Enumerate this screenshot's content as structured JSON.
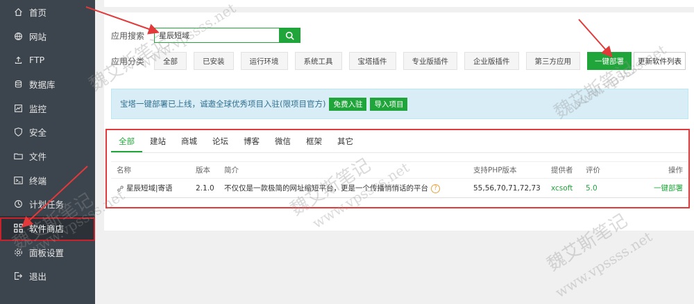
{
  "sidebar": {
    "items": [
      {
        "label": "首页",
        "icon": "home-icon"
      },
      {
        "label": "网站",
        "icon": "globe-icon"
      },
      {
        "label": "FTP",
        "icon": "upload-icon"
      },
      {
        "label": "数据库",
        "icon": "database-icon"
      },
      {
        "label": "监控",
        "icon": "monitor-icon"
      },
      {
        "label": "安全",
        "icon": "shield-icon"
      },
      {
        "label": "文件",
        "icon": "folder-icon"
      },
      {
        "label": "终端",
        "icon": "terminal-icon"
      },
      {
        "label": "计划任务",
        "icon": "clock-icon"
      },
      {
        "label": "软件商店",
        "icon": "grid-icon"
      },
      {
        "label": "面板设置",
        "icon": "gear-icon"
      },
      {
        "label": "退出",
        "icon": "logout-icon"
      }
    ],
    "active_index": 9
  },
  "search": {
    "label": "应用搜索",
    "value": "星辰短域"
  },
  "categories": {
    "label": "应用分类",
    "items": [
      "全部",
      "已安装",
      "运行环境",
      "系统工具",
      "宝塔插件",
      "专业版插件",
      "企业版插件",
      "第三方应用"
    ],
    "deploy_label": "一键部署",
    "update_label": "更新软件列表"
  },
  "banner": {
    "text": "宝塔一键部署已上线，诚邀全球优秀项目入驻(限项目官方)",
    "btn_join": "免费入驻",
    "btn_import": "导入项目"
  },
  "tabs": {
    "items": [
      "全部",
      "建站",
      "商城",
      "论坛",
      "博客",
      "微信",
      "框架",
      "其它"
    ],
    "active_index": 0
  },
  "table": {
    "headers": {
      "name": "名称",
      "version": "版本",
      "desc": "简介",
      "php": "支持PHP版本",
      "provider": "提供者",
      "rating": "评价",
      "op": "操作"
    },
    "rows": [
      {
        "name": "星辰短域|寄语",
        "version": "2.1.0",
        "desc": "不仅仅是一款极简的网址缩短平台，更是一个传播悄悄话的平台",
        "php": "55,56,70,71,72,73",
        "provider": "xcsoft",
        "rating": "5.0",
        "op": "一键部署"
      }
    ]
  },
  "watermark": {
    "text_cn": "魏艾斯笔记",
    "text_url": "www.vpssss.net"
  },
  "colors": {
    "accent": "#20a53a",
    "sidebar_bg": "#3c444d",
    "annotation_red": "#e23a3a"
  }
}
